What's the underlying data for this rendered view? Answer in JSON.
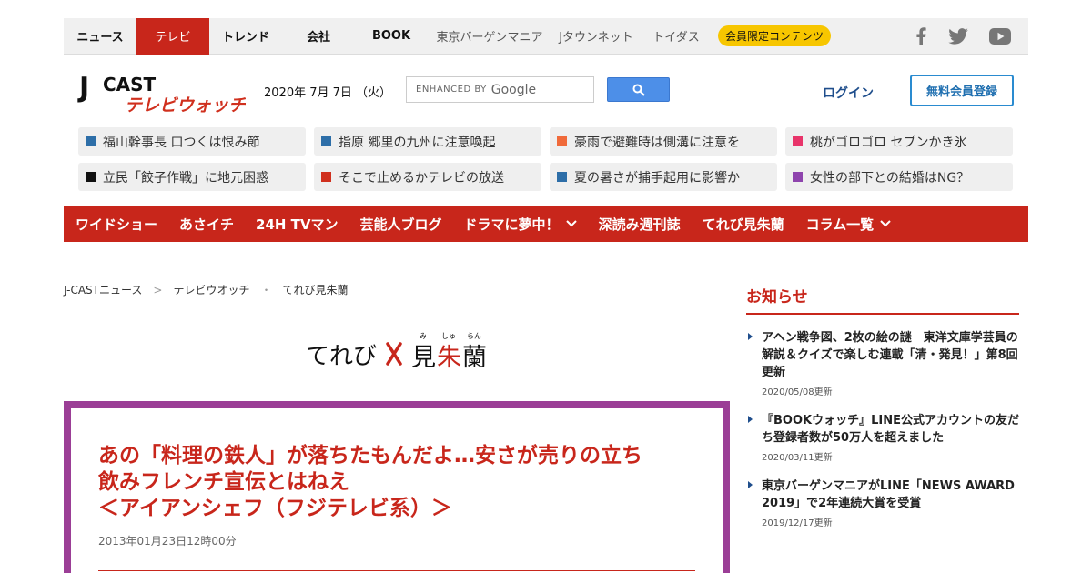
{
  "topnav": {
    "items": [
      {
        "label": "ニュース"
      },
      {
        "label": "テレビ"
      },
      {
        "label": "トレンド"
      },
      {
        "label": "会社"
      },
      {
        "label": "BOOK"
      },
      {
        "label": "東京バーゲンマニア"
      },
      {
        "label": "Jタウンネット"
      },
      {
        "label": "トイダス"
      }
    ],
    "member_label": "会員限定コンテンツ",
    "active_color": "#c8261b",
    "member_color": "#f7c600"
  },
  "social": {
    "icons": [
      "facebook-icon",
      "twitter-icon",
      "youtube-icon"
    ]
  },
  "header": {
    "logo_top": "J CAST",
    "logo_bottom": "テレビウォッチ",
    "date": "2020年 7月 7日 （火）",
    "search_label": "ENHANCED BY",
    "search_brand": "Google",
    "login_label": "ログイン",
    "register_label": "無料会員登録"
  },
  "topics": [
    {
      "text": "福山幹事長 口つくは恨み節",
      "color": "#2d6ea8"
    },
    {
      "text": "指原 郷里の九州に注意喚起",
      "color": "#2d6ea8"
    },
    {
      "text": "豪雨で避難時は側溝に注意を",
      "color": "#f06a3a"
    },
    {
      "text": "桃がゴロゴロ セブンかき氷",
      "color": "#e8346a"
    },
    {
      "text": "立民「餃子作戦」に地元困惑",
      "color": "#111111"
    },
    {
      "text": "そこで止めるかテレビの放送",
      "color": "#d0301e"
    },
    {
      "text": "夏の暑さが捕手起用に影響か",
      "color": "#2d6ea8"
    },
    {
      "text": "女性の部下との結婚はNG？",
      "color": "#8e44ad"
    }
  ],
  "rednav": {
    "items": [
      {
        "label": "ワイドショー"
      },
      {
        "label": "あさイチ"
      },
      {
        "label": "24H TVマン"
      },
      {
        "label": "芸能人ブログ"
      },
      {
        "label": "ドラマに夢中！"
      },
      {
        "label": "深読み週刊誌"
      },
      {
        "label": "てれび見朱蘭"
      },
      {
        "label": "コラム一覧"
      }
    ]
  },
  "breadcrumb": {
    "items": [
      "J-CASTニュース",
      "テレビウオッチ",
      "てれび見朱蘭"
    ],
    "sep1": ">",
    "sep2": "・"
  },
  "column_logo": {
    "text_a": "てれび",
    "text_b": "見",
    "text_c": "朱",
    "text_d": "蘭",
    "ruby_a": "み",
    "ruby_b": "しゅ",
    "ruby_c": "らん"
  },
  "article": {
    "title_line1": "あの「料理の鉄人」が落ちたもんだよ…安さが売りの立ち",
    "title_line2": "飲みフレンチ宣伝とはねえ",
    "title_line3": "＜アイアンシェフ（フジテレビ系）＞",
    "date": "2013年01月23日12時00分",
    "frame_color": "#9b3e96"
  },
  "sidebar": {
    "title": "お知らせ",
    "news": [
      {
        "text": "アヘン戦争図、2枚の絵の謎　東洋文庫学芸員の解説＆クイズで楽しむ連載「清・発見！」第8回更新",
        "date": "2020/05/08更新"
      },
      {
        "text": "『BOOKウォッチ』LINE公式アカウントの友だち登録者数が50万人を超えました",
        "date": "2020/03/11更新"
      },
      {
        "text": "東京バーゲンマニアがLINE「NEWS AWARD 2019」で2年連続大賞を受賞",
        "date": "2019/12/17更新"
      }
    ]
  }
}
